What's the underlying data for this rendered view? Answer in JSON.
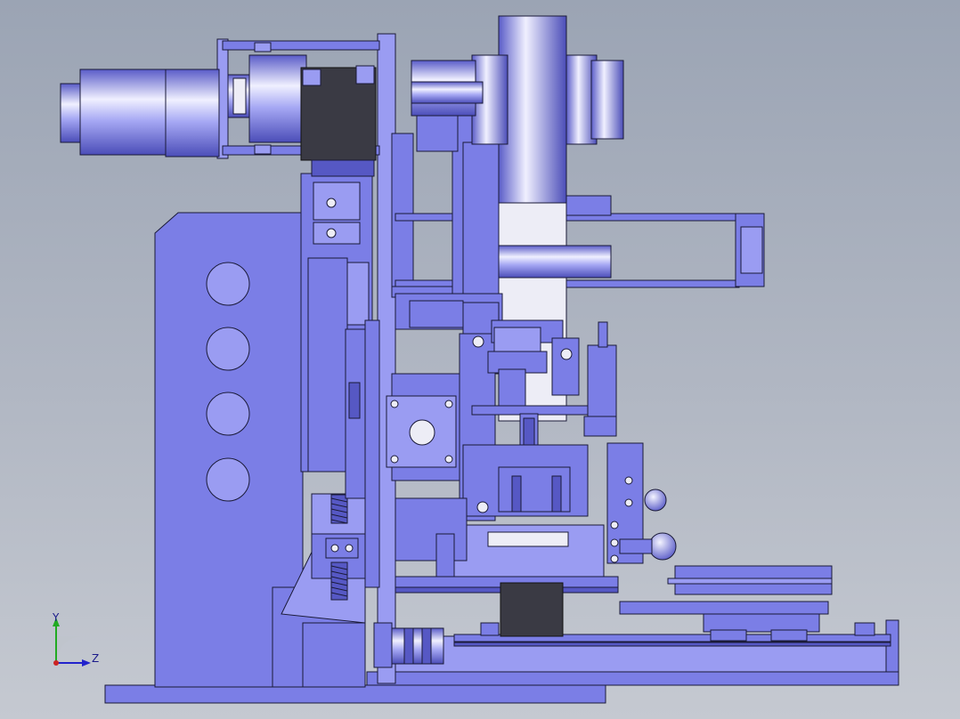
{
  "colors": {
    "background_top": "#9ba4b4",
    "background_bottom": "#c5c9d1",
    "part_base": "#7b7ee6",
    "part_light": "#9a9cf2",
    "part_dark": "#5658c4",
    "part_white": "#ededf6",
    "motor_dark": "#3a3a44",
    "edge": "#1a1a38",
    "axis_y": "#22aa22",
    "axis_z": "#2222cc",
    "axis_x": "#cc2222"
  },
  "triad": {
    "y_label": "Y",
    "z_label": "Z"
  }
}
